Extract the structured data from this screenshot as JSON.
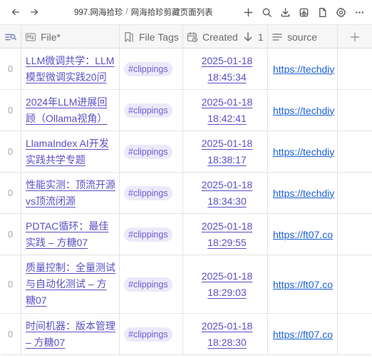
{
  "titlebar": {
    "breadcrumb_parent": "997.网海拾珍",
    "breadcrumb_separator": "/",
    "breadcrumb_current": "网海拾珍剪藏页面列表"
  },
  "table": {
    "headers": {
      "file": "File*",
      "tags": "File Tags",
      "created": "Created",
      "created_sort_index": "1",
      "source": "source"
    },
    "rows": [
      {
        "index": "0",
        "file": "LLM微调共学：LLM模型微调实践20问",
        "tag": "#clippings",
        "date": "2025-01-18",
        "time": "18:45:34",
        "source": "https://techdiy"
      },
      {
        "index": "0",
        "file": "2024年LLM进展回顾（Ollama视角）",
        "tag": "#clippings",
        "date": "2025-01-18",
        "time": "18:42:41",
        "source": "https://techdiy"
      },
      {
        "index": "0",
        "file": "LlamaIndex AI开发实践共学专题",
        "tag": "#clippings",
        "date": "2025-01-18",
        "time": "18:38:17",
        "source": "https://techdiy"
      },
      {
        "index": "0",
        "file": "性能实测：顶流开源vs顶流闭源",
        "tag": "#clippings",
        "date": "2025-01-18",
        "time": "18:34:30",
        "source": "https://techdiy"
      },
      {
        "index": "0",
        "file": "PDTAC循环：最佳实践 – 方糖07",
        "tag": "#clippings",
        "date": "2025-01-18",
        "time": "18:29:55",
        "source": "https://ft07.co"
      },
      {
        "index": "0",
        "file": "质量控制：全量测试与自动化测试 – 方糖07",
        "tag": "#clippings",
        "date": "2025-01-18",
        "time": "18:29:03",
        "source": "https://ft07.co"
      },
      {
        "index": "0",
        "file": "时间机器：版本管理 – 方糖07",
        "tag": "#clippings",
        "date": "2025-01-18",
        "time": "18:28:30",
        "source": "https://ft07.co"
      }
    ]
  }
}
